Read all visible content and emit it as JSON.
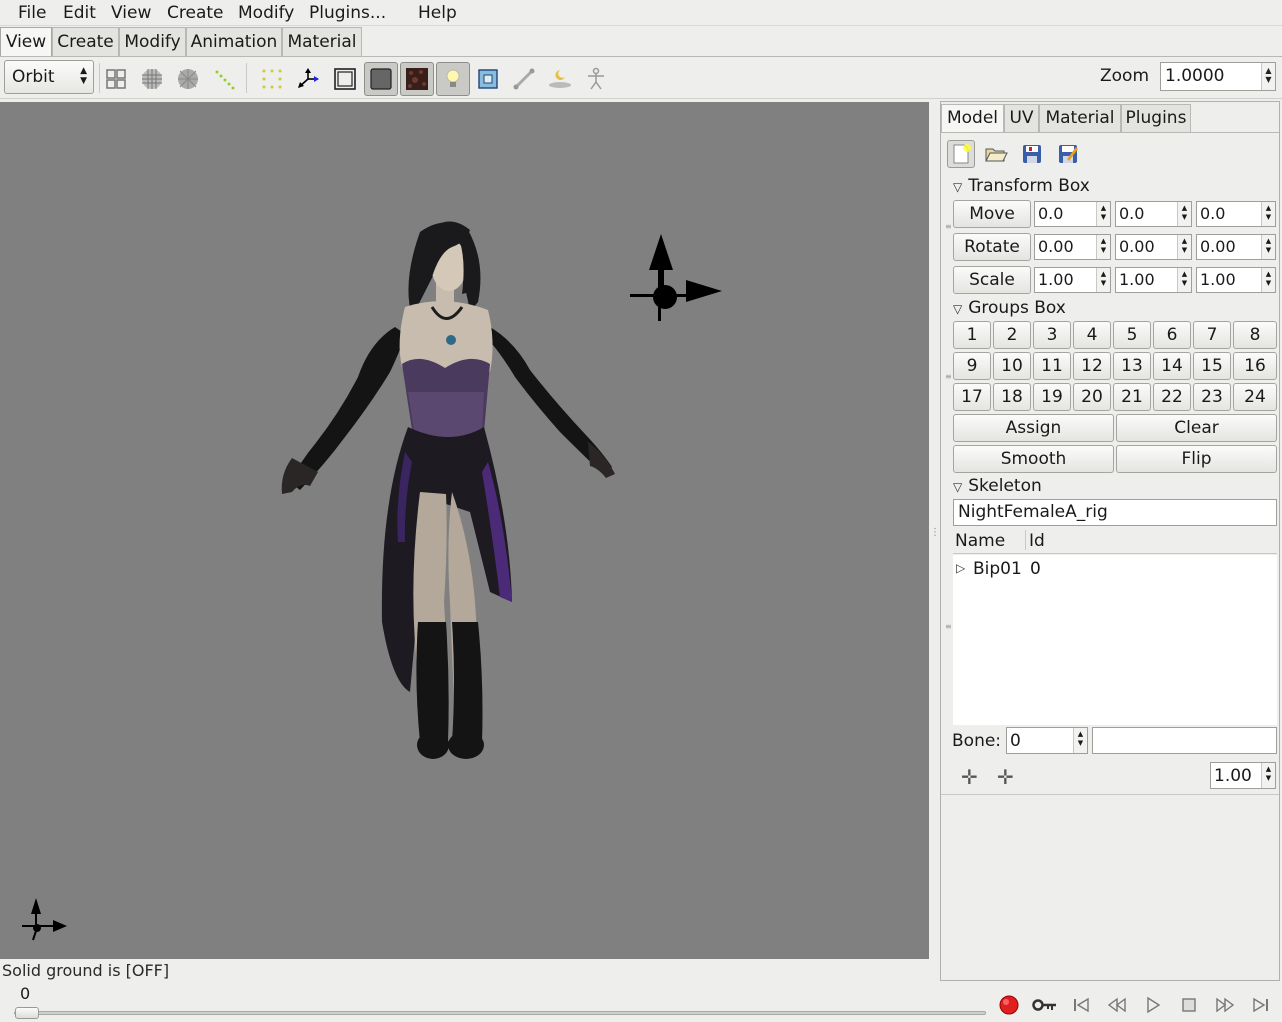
{
  "menu": {
    "file": "File",
    "edit": "Edit",
    "view": "View",
    "create": "Create",
    "modify": "Modify",
    "plugins": "Plugins...",
    "help": "Help"
  },
  "mode_tabs": [
    "View",
    "Create",
    "Modify",
    "Animation",
    "Material"
  ],
  "toolbar": {
    "mode_select": "Orbit",
    "zoom_label": "Zoom",
    "zoom_value": "1.0000",
    "icons": [
      "grid-view-icon",
      "wireframe-icon",
      "flat-shade-icon",
      "vertices-icon",
      "selection-points-icon",
      "axis-icon",
      "frame-icon",
      "smooth-shade-icon",
      "texture-icon",
      "light-icon",
      "fit-view-icon",
      "bone-icon",
      "ground-icon",
      "skeleton-icon"
    ]
  },
  "viewport": {
    "background": "#808080"
  },
  "status": {
    "message": "Solid ground is [OFF]"
  },
  "panel": {
    "tabs": [
      "Model",
      "UV",
      "Material",
      "Plugins"
    ],
    "transform": {
      "title": "Transform Box",
      "rows": [
        {
          "label": "Move",
          "values": [
            "0.0",
            "0.0",
            "0.0"
          ]
        },
        {
          "label": "Rotate",
          "values": [
            "0.00",
            "0.00",
            "0.00"
          ]
        },
        {
          "label": "Scale",
          "values": [
            "1.00",
            "1.00",
            "1.00"
          ]
        }
      ]
    },
    "groups": {
      "title": "Groups Box",
      "numbers": [
        "1",
        "2",
        "3",
        "4",
        "5",
        "6",
        "7",
        "8",
        "9",
        "10",
        "11",
        "12",
        "13",
        "14",
        "15",
        "16",
        "17",
        "18",
        "19",
        "20",
        "21",
        "22",
        "23",
        "24"
      ],
      "assign": "Assign",
      "clear": "Clear",
      "smooth": "Smooth",
      "flip": "Flip"
    },
    "skeleton": {
      "title": "Skeleton",
      "name": "NightFemaleA_rig",
      "col_name": "Name",
      "col_id": "Id",
      "rows": [
        {
          "name": "Bip01",
          "id": "0"
        }
      ],
      "bone_label": "Bone:",
      "bone_value": "0",
      "bone_name": "",
      "weight": "1.00"
    }
  },
  "timeline": {
    "frame": "0",
    "record_color": "#e02020"
  }
}
